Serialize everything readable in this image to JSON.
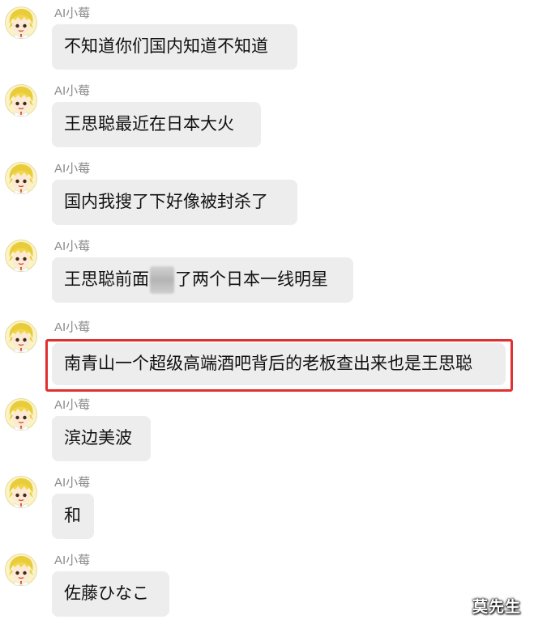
{
  "chat": {
    "messages": [
      {
        "sender": "AI小莓",
        "text": "不知道你们国内知道不知道"
      },
      {
        "sender": "AI小莓",
        "text": "王思聪最近在日本大火"
      },
      {
        "sender": "AI小莓",
        "text": "国内我搜了下好像被封杀了"
      },
      {
        "sender": "AI小莓",
        "text_before": "王思聪前面",
        "text_after": "了两个日本一线明星"
      },
      {
        "sender": "AI小莓",
        "text": "南青山一个超级高端酒吧背后的老板查出来也是王思聪",
        "highlighted": true
      },
      {
        "sender": "AI小莓",
        "text": "滨边美波"
      },
      {
        "sender": "AI小莓",
        "text": "和"
      },
      {
        "sender": "AI小莓",
        "text": "佐藤ひなこ"
      }
    ]
  },
  "highlight_color": "#e03030",
  "bubble_color": "#ededed",
  "avatar_icon": "anime-character-avatar",
  "watermark": "莫先生"
}
